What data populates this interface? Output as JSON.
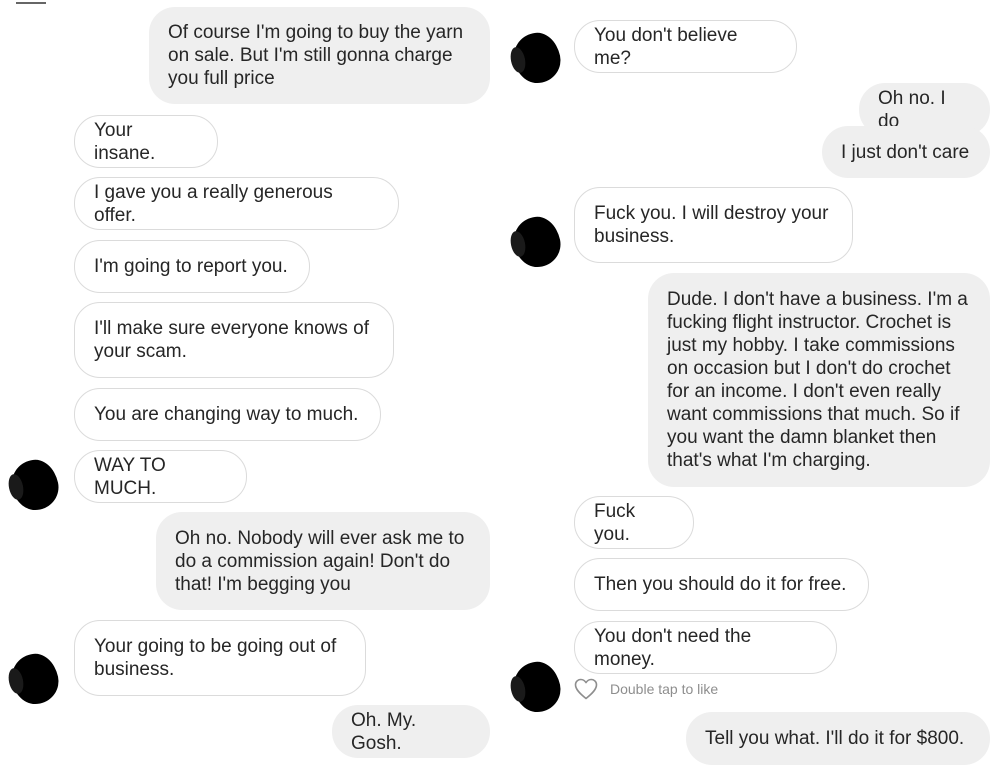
{
  "left_column": {
    "messages": [
      {
        "type": "sent",
        "text": "Of course I'm going to buy the yarn on sale. But I'm still gonna charge you full price"
      },
      {
        "type": "received",
        "text": "Your insane."
      },
      {
        "type": "received",
        "text": "I gave you a really generous offer."
      },
      {
        "type": "received",
        "text": "I'm going to report you."
      },
      {
        "type": "received",
        "text": "I'll make sure everyone knows of your scam."
      },
      {
        "type": "received",
        "text": "You are changing way to much."
      },
      {
        "type": "received",
        "text": "WAY TO MUCH."
      },
      {
        "type": "sent",
        "text": "Oh no. Nobody will ever ask me to do a commission again! Don't do that! I'm begging you"
      },
      {
        "type": "received",
        "text": "Your going to be going out of business."
      },
      {
        "type": "sent",
        "text": "Oh. My. Gosh."
      }
    ]
  },
  "right_column": {
    "messages": [
      {
        "type": "received",
        "text": "You don't believe me?"
      },
      {
        "type": "sent",
        "text": "Oh no. I do"
      },
      {
        "type": "sent",
        "text": "I just don't care"
      },
      {
        "type": "received",
        "text": "Fuck you. I will destroy your business."
      },
      {
        "type": "sent",
        "text": "Dude. I don't have a business. I'm a fucking flight instructor. Crochet is just my hobby. I take commissions on occasion but I don't do crochet for an income. I don't even really want commissions that much. So if you want the damn blanket then that's what I'm charging."
      },
      {
        "type": "received",
        "text": "Fuck you."
      },
      {
        "type": "received",
        "text": "Then you should do it for free."
      },
      {
        "type": "received",
        "text": "You don't need the money."
      },
      {
        "type": "sent",
        "text": "Tell you what. I'll do it for $800."
      }
    ],
    "like_hint": "Double tap to like",
    "like_icon": "heart-outline-icon"
  },
  "colors": {
    "sent_bubble": "#efefef",
    "received_border": "#dbdbdb",
    "text": "#262626",
    "hint_text": "#8e8e8e"
  }
}
